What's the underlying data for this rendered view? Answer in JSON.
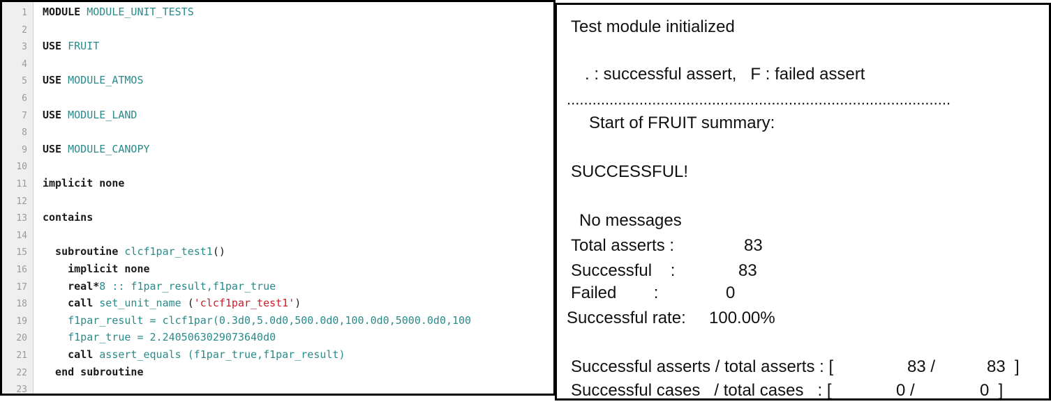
{
  "editor": {
    "lines": [
      {
        "num": "1",
        "parts": [
          {
            "c": "kw",
            "t": "MODULE "
          },
          {
            "c": "id",
            "t": "MODULE_UNIT_TESTS"
          }
        ]
      },
      {
        "num": "2",
        "parts": []
      },
      {
        "num": "3",
        "parts": [
          {
            "c": "kw",
            "t": "USE "
          },
          {
            "c": "id",
            "t": "FRUIT"
          }
        ]
      },
      {
        "num": "4",
        "parts": []
      },
      {
        "num": "5",
        "parts": [
          {
            "c": "kw",
            "t": "USE "
          },
          {
            "c": "id",
            "t": "MODULE_ATMOS"
          }
        ]
      },
      {
        "num": "6",
        "parts": []
      },
      {
        "num": "7",
        "parts": [
          {
            "c": "kw",
            "t": "USE "
          },
          {
            "c": "id",
            "t": "MODULE_LAND"
          }
        ]
      },
      {
        "num": "8",
        "parts": []
      },
      {
        "num": "9",
        "parts": [
          {
            "c": "kw",
            "t": "USE "
          },
          {
            "c": "id",
            "t": "MODULE_CANOPY"
          }
        ]
      },
      {
        "num": "10",
        "parts": []
      },
      {
        "num": "11",
        "parts": [
          {
            "c": "kw",
            "t": "implicit none"
          }
        ]
      },
      {
        "num": "12",
        "parts": []
      },
      {
        "num": "13",
        "parts": [
          {
            "c": "kw",
            "t": "contains"
          }
        ]
      },
      {
        "num": "14",
        "parts": []
      },
      {
        "num": "15",
        "parts": [
          {
            "c": "kw",
            "t": "  subroutine "
          },
          {
            "c": "id",
            "t": "clcf1par_test1"
          },
          {
            "c": "pl",
            "t": "()"
          }
        ]
      },
      {
        "num": "16",
        "parts": [
          {
            "c": "kw",
            "t": "    implicit none"
          }
        ]
      },
      {
        "num": "17",
        "parts": [
          {
            "c": "kw",
            "t": "    real*"
          },
          {
            "c": "id",
            "t": "8 :: f1par_result,f1par_true"
          }
        ]
      },
      {
        "num": "18",
        "parts": [
          {
            "c": "kw",
            "t": "    call "
          },
          {
            "c": "id",
            "t": "set_unit_name "
          },
          {
            "c": "pl",
            "t": "("
          },
          {
            "c": "str",
            "t": "'clcf1par_test1'"
          },
          {
            "c": "pl",
            "t": ")"
          }
        ]
      },
      {
        "num": "19",
        "parts": [
          {
            "c": "id",
            "t": "    f1par_result = clcf1par(0.3d0,5.0d0,500.0d0,100.0d0,5000.0d0,100"
          }
        ]
      },
      {
        "num": "20",
        "parts": [
          {
            "c": "id",
            "t": "    f1par_true = 2.2405063029073640d0"
          }
        ]
      },
      {
        "num": "21",
        "parts": [
          {
            "c": "kw",
            "t": "    call "
          },
          {
            "c": "id",
            "t": "assert_equals (f1par_true,f1par_result)"
          }
        ]
      },
      {
        "num": "22",
        "parts": [
          {
            "c": "kw",
            "t": "  end subroutine"
          }
        ]
      },
      {
        "num": "23",
        "parts": []
      }
    ]
  },
  "output": {
    "initialized": "Test module initialized",
    "legend": ". : successful assert,   F : failed assert",
    "dots": "..........................................................................................",
    "summary_start": "Start of FRUIT summary:",
    "status": "SUCCESSFUL!",
    "messages": "No messages",
    "total_asserts_label": "Total asserts :",
    "total_asserts_value": "83",
    "successful_label": "Successful    :",
    "successful_value": "83",
    "failed_label": "Failed        :",
    "failed_value": "0",
    "rate_label": "Successful rate:",
    "rate_value": "100.00%",
    "asserts_ratio_label": "Successful asserts / total asserts : [",
    "asserts_ratio_a": "83 /",
    "asserts_ratio_b": "83  ]",
    "cases_ratio_label": "Successful cases   / total cases   : [",
    "cases_ratio_a": "0 /",
    "cases_ratio_b": "0  ]"
  }
}
